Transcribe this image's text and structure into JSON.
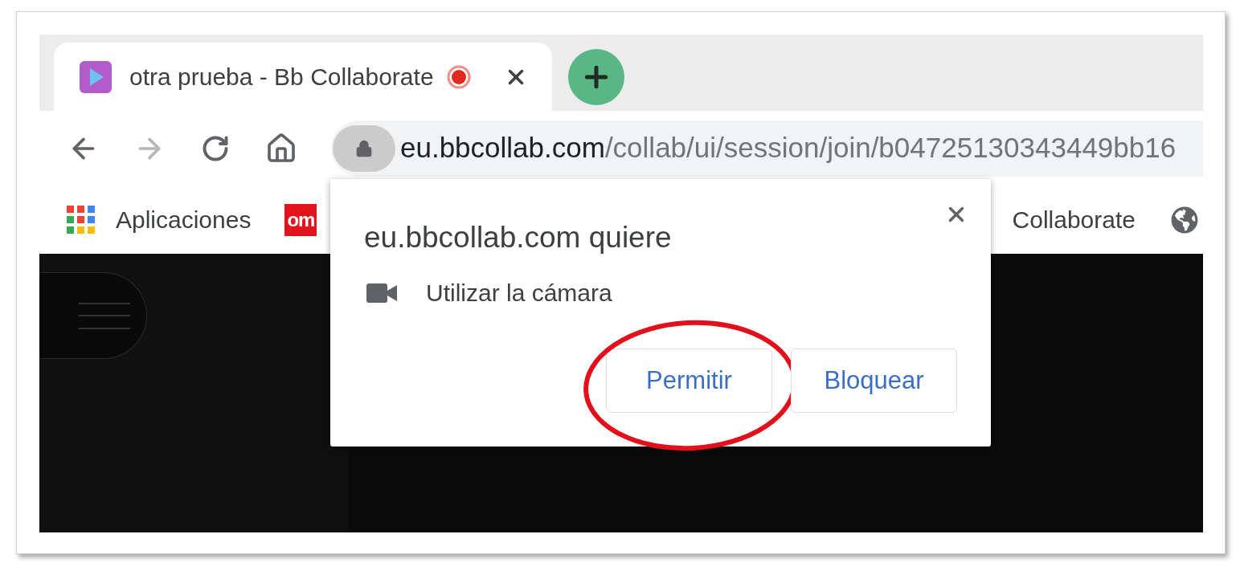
{
  "tabs": [
    {
      "title": "otra prueba - Bb Collaborate",
      "selected": true,
      "recording": true
    }
  ],
  "toolbar": {
    "buttons": [
      {
        "kind": "back",
        "disabled": false
      },
      {
        "kind": "forward",
        "disabled": true
      },
      {
        "kind": "reload",
        "disabled": false
      },
      {
        "kind": "home",
        "disabled": false
      }
    ]
  },
  "address_bar": {
    "host": "eu.bbcollab.com",
    "path": "/collab/ui/session/join/b04725130343449bb16",
    "secure": true
  },
  "bookmarks": [
    {
      "kind": "apps",
      "label": "Aplicaciones"
    },
    {
      "kind": "favicon",
      "icon_text": "om"
    },
    {
      "kind": "link",
      "label": "Collaborate"
    },
    {
      "kind": "globe"
    }
  ],
  "popup": {
    "title": "eu.bbcollab.com quiere",
    "permissions": [
      {
        "kind": "camera",
        "label": "Utilizar la cámara"
      }
    ],
    "buttons": [
      {
        "label": "Permitir",
        "highlighted": true
      },
      {
        "label": "Bloquear",
        "highlighted": false
      }
    ]
  }
}
